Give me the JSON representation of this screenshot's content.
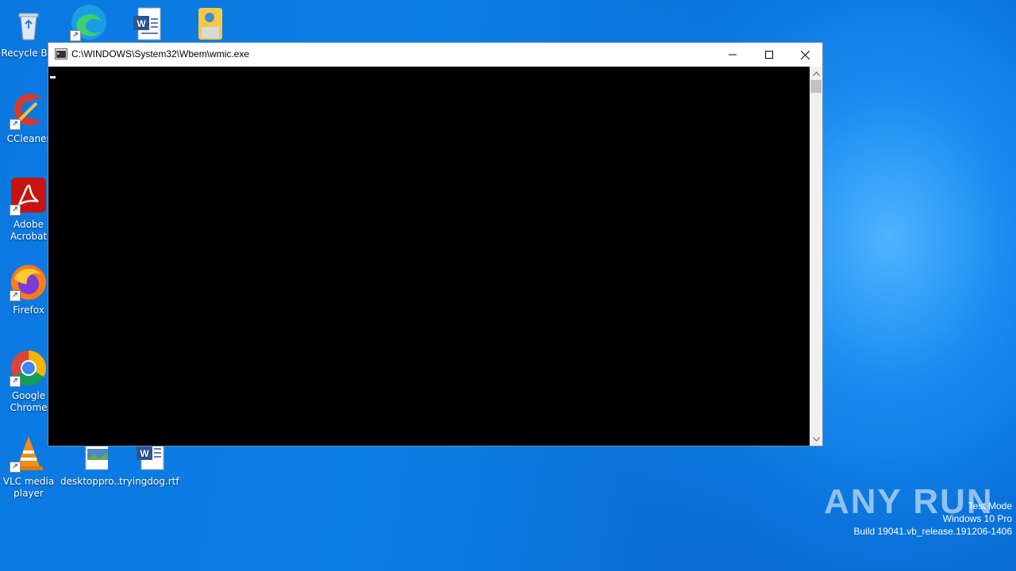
{
  "desktop": {
    "icons": [
      {
        "label": "Recycle Bin",
        "icon": "recycle-bin-icon"
      },
      {
        "label": "",
        "icon": "edge-icon"
      },
      {
        "label": "",
        "icon": "word-document-icon"
      },
      {
        "label": "",
        "icon": "folder-icon"
      },
      {
        "label": "CCleaner",
        "icon": "ccleaner-icon"
      },
      {
        "label": "Adobe Acrobat",
        "icon": "adobe-acrobat-icon"
      },
      {
        "label": "Firefox",
        "icon": "firefox-icon"
      },
      {
        "label": "Google Chrome",
        "icon": "chrome-icon"
      },
      {
        "label": "VLC media player",
        "icon": "vlc-icon"
      },
      {
        "label": "desktoppro...",
        "icon": "image-file-icon"
      },
      {
        "label": "tryingdog.rtf",
        "icon": "word-document-icon"
      }
    ]
  },
  "window": {
    "title": "C:\\WINDOWS\\System32\\Wbem\\wmic.exe",
    "minimize": "minimize",
    "maximize": "maximize",
    "close": "close"
  },
  "watermark": {
    "brand": "ANY RUN",
    "line1": "Test Mode",
    "line2": "Windows 10 Pro",
    "line3": "Build 19041.vb_release.191206-1406"
  },
  "colors": {
    "desktop": "#0a74dc",
    "console": "#000000"
  }
}
